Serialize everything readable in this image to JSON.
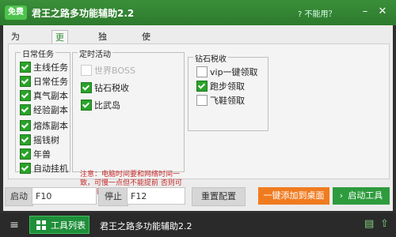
{
  "titlebar": {
    "badge": "免费",
    "title": "君王之路多功能辅助2.2",
    "help": "不能用？",
    "min": "–",
    "close": "✕"
  },
  "tabs": [
    {
      "label": "为您设置"
    },
    {
      "label": "更多设置"
    },
    {
      "label": "独立功能"
    },
    {
      "label": "使用说明"
    }
  ],
  "groups": {
    "daily": {
      "title": "日常任务",
      "items": [
        {
          "label": "主线任务",
          "checked": true
        },
        {
          "label": "日常任务",
          "checked": true
        },
        {
          "label": "真气副本",
          "checked": true
        },
        {
          "label": "经验副本",
          "checked": true
        },
        {
          "label": "熔炼副本",
          "checked": true
        },
        {
          "label": "摇钱树",
          "checked": true
        },
        {
          "label": "年兽",
          "checked": true
        },
        {
          "label": "自动挂机",
          "checked": true
        }
      ]
    },
    "timed": {
      "title": "定时活动",
      "items": [
        {
          "label": "世界BOSS",
          "checked": false,
          "disabled": true
        },
        {
          "label": "钻石税收",
          "checked": true
        },
        {
          "label": "比武岛",
          "checked": true
        }
      ]
    },
    "diamond": {
      "title": "钻石税收",
      "items": [
        {
          "label": "vip一键领取",
          "checked": false
        },
        {
          "label": "跑步领取",
          "checked": true
        },
        {
          "label": "飞鞋领取",
          "checked": false
        }
      ]
    }
  },
  "note": "注意：电脑时间要和网络时间一致，可慢一点但不能提前 否则可能出错",
  "controls": {
    "start_label": "启动",
    "start_key": "F10",
    "stop_label": "停止",
    "stop_key": "F12",
    "reset_label": "重置配置",
    "desktop_label": "一键添加到桌面",
    "launch_label": "启动工具"
  },
  "taskbar": {
    "tools_label": "工具列表",
    "window_title": "君王之路多功能辅助2.2"
  }
}
